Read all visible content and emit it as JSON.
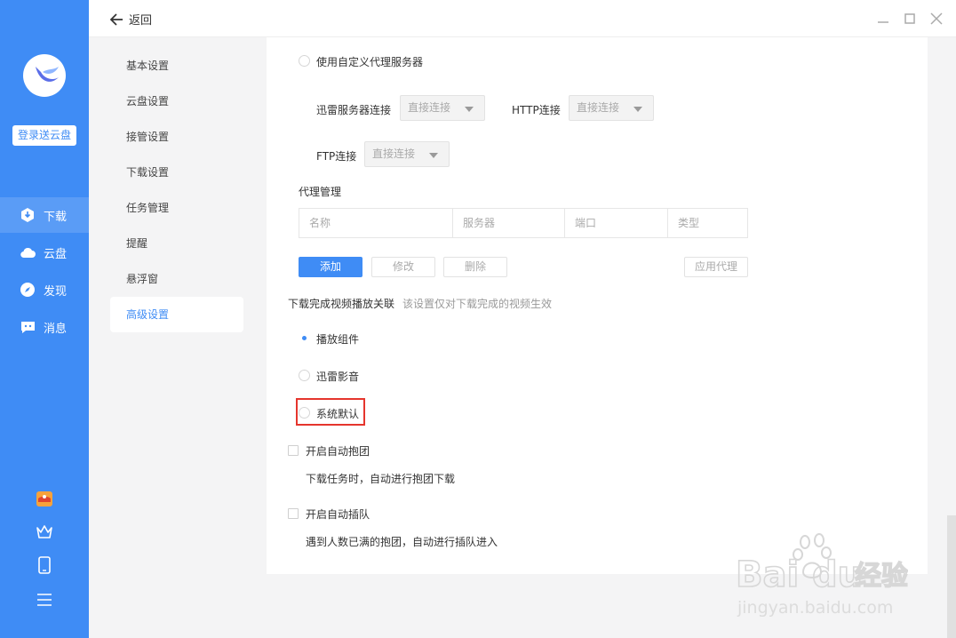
{
  "rail": {
    "login_button": "登录送云盘",
    "nav": [
      {
        "label": "下载",
        "icon": "download-icon",
        "active": true
      },
      {
        "label": "云盘",
        "icon": "cloud-icon",
        "active": false
      },
      {
        "label": "发现",
        "icon": "compass-icon",
        "active": false
      },
      {
        "label": "消息",
        "icon": "message-icon",
        "active": false
      }
    ],
    "bottom_icons": [
      "gift-icon",
      "crown-icon",
      "phone-icon",
      "menu-icon"
    ]
  },
  "topbar": {
    "back_label": "返回",
    "window_controls": [
      "minimize-icon",
      "maximize-icon",
      "close-icon"
    ]
  },
  "settings_menu": {
    "items": [
      "基本设置",
      "云盘设置",
      "接管设置",
      "下载设置",
      "任务管理",
      "提醒",
      "悬浮窗",
      "高级设置"
    ],
    "active": "高级设置"
  },
  "proxy": {
    "custom_proxy_label": "使用自定义代理服务器",
    "xunlei_conn_label": "迅雷服务器连接",
    "xunlei_conn_value": "直接连接",
    "http_conn_label": "HTTP连接",
    "http_conn_value": "直接连接",
    "ftp_conn_label": "FTP连接",
    "ftp_conn_value": "直接连接",
    "manage_title": "代理管理",
    "columns": [
      "名称",
      "服务器",
      "端口",
      "类型"
    ],
    "buttons": {
      "add": "添加",
      "edit": "修改",
      "delete": "删除",
      "apply": "应用代理"
    }
  },
  "video_assoc": {
    "title": "下载完成视频播放关联",
    "hint": "该设置仅对下载完成的视频生效",
    "options": [
      {
        "label": "播放组件",
        "selected": true
      },
      {
        "label": "迅雷影音",
        "selected": false
      },
      {
        "label": "系统默认",
        "selected": false
      }
    ]
  },
  "auto_group": {
    "label": "开启自动抱团",
    "desc": "下载任务时，自动进行抱团下载"
  },
  "auto_queue": {
    "label": "开启自动插队",
    "desc": "遇到人数已满的抱团，自动进行插队进入"
  },
  "watermark": {
    "brand": "Bai",
    "brand2": "du",
    "brand_cn": "经验",
    "url": "jingyan.baidu.com"
  },
  "colors": {
    "accent": "#3f8cf5",
    "highlight": "#e5352d"
  }
}
